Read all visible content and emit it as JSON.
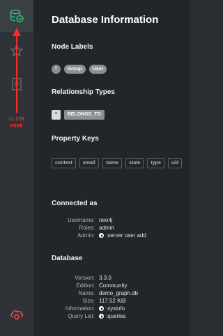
{
  "rail": {
    "buttons": [
      {
        "name": "database-icon",
        "active": true
      },
      {
        "name": "star-icon",
        "active": false
      },
      {
        "name": "document-icon",
        "active": false
      }
    ],
    "bottom_icon": "cloud-icon",
    "annotation": "CLICK HERE",
    "accent": "#2dbd7a",
    "annotation_color": "#ff2a2a"
  },
  "panel": {
    "title": "Database Information",
    "node_labels": {
      "heading": "Node Labels",
      "items": [
        "*",
        "Group",
        "User"
      ]
    },
    "relationship_types": {
      "heading": "Relationship Types",
      "items": [
        "*",
        "BELONGS_TO"
      ]
    },
    "property_keys": {
      "heading": "Property Keys",
      "items": [
        "context",
        "email",
        "name",
        "state",
        "type",
        "uid"
      ]
    },
    "connected_as": {
      "heading": "Connected as",
      "rows": [
        {
          "k": "Username:",
          "v": "neo4j"
        },
        {
          "k": "Roles:",
          "v": "admin"
        },
        {
          "k": "Admin:",
          "v": ":server user add"
        }
      ]
    },
    "database": {
      "heading": "Database",
      "rows": [
        {
          "k": "Version:",
          "v": "3.3.0"
        },
        {
          "k": "Edition:",
          "v": "Community"
        },
        {
          "k": "Name:",
          "v": "demo_graph.db"
        },
        {
          "k": "Size:",
          "v": "117.52 KiB"
        },
        {
          "k": "Information:",
          "v": ":sysinfo"
        },
        {
          "k": "Query List:",
          "v": ":queries"
        }
      ]
    }
  }
}
